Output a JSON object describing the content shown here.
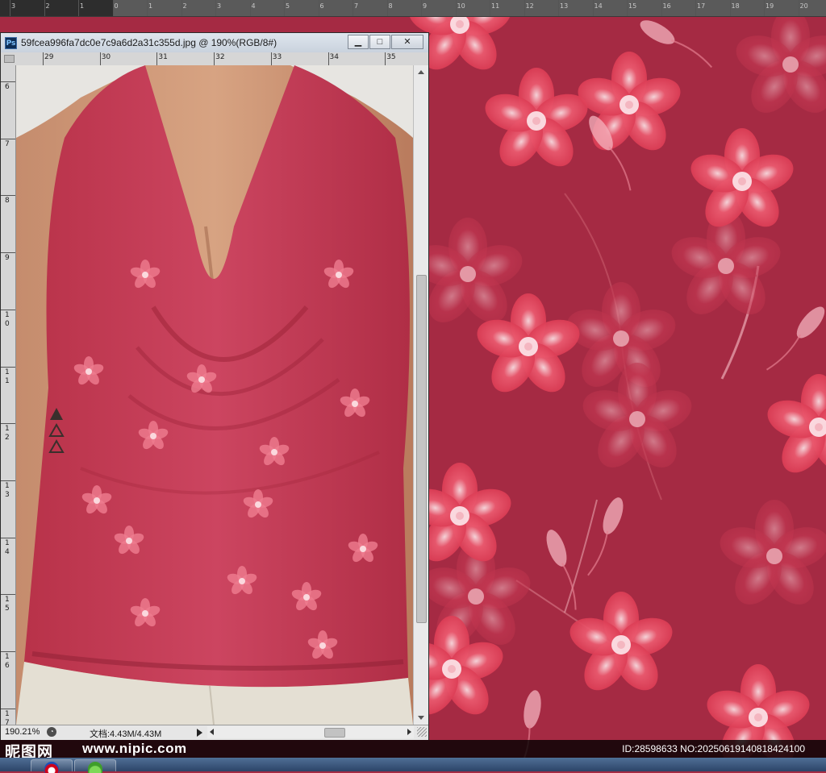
{
  "window": {
    "app_badge": "Ps",
    "title": "59fcea996fa7dc0e7c9a6d2a31c355d.jpg @ 190%(RGB/8#)",
    "buttons": {
      "minimize": "▁",
      "maximize": "□",
      "close": "✕"
    }
  },
  "ruler_top": {
    "labels": [
      "3",
      "2",
      "1",
      "0",
      "1",
      "2",
      "3",
      "4",
      "5",
      "6",
      "7",
      "8",
      "9",
      "10",
      "11",
      "12",
      "13",
      "14",
      "15",
      "16",
      "17",
      "18",
      "19",
      "20"
    ]
  },
  "ruler_h": {
    "labels": [
      "29",
      "30",
      "31",
      "32",
      "33",
      "34",
      "35"
    ]
  },
  "ruler_v": {
    "labels": [
      "6",
      "7",
      "8",
      "9",
      "1\n0",
      "1\n1",
      "1\n2",
      "1\n3",
      "1\n4",
      "1\n5",
      "1\n6",
      "1\n7"
    ]
  },
  "status": {
    "zoom": "190.21%",
    "doc_size": "文档:4.43M/4.43M"
  },
  "watermark": {
    "logo": "昵图网",
    "url": "www.nipic.com",
    "id_text": "ID:28598633 NO:20250619140818424100"
  },
  "colors": {
    "fabric": "#a52a43",
    "flower": "#e23a52",
    "flower_light": "#f7c3cb",
    "ps_chrome": "#535353"
  },
  "taskbar": {
    "items": [
      {
        "icon": "browser-icon"
      },
      {
        "icon": "messenger-icon"
      }
    ]
  }
}
